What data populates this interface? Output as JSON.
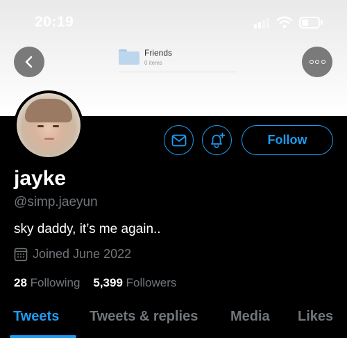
{
  "status_bar": {
    "time": "20:19"
  },
  "nav": {
    "folder_name": "Friends",
    "folder_count": "0 items"
  },
  "profile": {
    "display_name": "jayke",
    "handle": "@simp.jaeyun",
    "bio": "sky daddy, it’s me again..",
    "joined": "Joined June 2022",
    "following_count": "28",
    "following_label": "Following",
    "followers_count": "5,399",
    "followers_label": "Followers"
  },
  "actions": {
    "follow_label": "Follow"
  },
  "tabs": [
    {
      "label": "Tweets",
      "active": true
    },
    {
      "label": "Tweets & replies",
      "active": false
    },
    {
      "label": "Media",
      "active": false
    },
    {
      "label": "Likes",
      "active": false
    }
  ],
  "colors": {
    "accent": "#1d9bf0",
    "muted": "#71767b",
    "background": "#000000",
    "text": "#ffffff"
  },
  "icons": [
    "back-chevron-icon",
    "more-dots-icon",
    "folder-icon",
    "mail-icon",
    "bell-plus-icon",
    "calendar-icon"
  ]
}
